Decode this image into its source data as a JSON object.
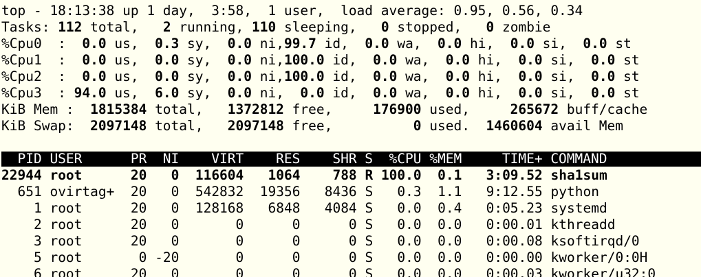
{
  "summary": {
    "line1": "top - 18:13:38 up 1 day,  3:58,  1 user,  load average: 0.95, 0.56, 0.34",
    "tasks": {
      "prefix": "Tasks: ",
      "total": "112",
      "total_label": " total,   ",
      "running": "2",
      "running_label": " running, ",
      "sleeping": "110",
      "sleeping_label": " sleeping,   ",
      "stopped": "0",
      "stopped_label": " stopped,   ",
      "zombie": "0",
      "zombie_label": " zombie"
    },
    "cpus": [
      {
        "label": "%Cpu0  : ",
        "us": " 0.0",
        "sy": " 0.3",
        "ni": " 0.0",
        "id": "99.7",
        "wa": " 0.0",
        "hi": " 0.0",
        "si": " 0.0",
        "st": " 0.0",
        "id_sep": " ni,"
      },
      {
        "label": "%Cpu1  : ",
        "us": " 0.0",
        "sy": " 0.0",
        "ni": " 0.0",
        "id": "100.0",
        "wa": " 0.0",
        "hi": " 0.0",
        "si": " 0.0",
        "st": " 0.0",
        "id_sep": " ni,"
      },
      {
        "label": "%Cpu2  : ",
        "us": " 0.0",
        "sy": " 0.0",
        "ni": " 0.0",
        "id": "100.0",
        "wa": " 0.0",
        "hi": " 0.0",
        "si": " 0.0",
        "st": " 0.0",
        "id_sep": " ni,"
      },
      {
        "label": "%Cpu3  : ",
        "us": "94.0",
        "sy": " 6.0",
        "ni": " 0.0",
        "id": " 0.0",
        "wa": " 0.0",
        "hi": " 0.0",
        "si": " 0.0",
        "st": " 0.0",
        "id_sep": " ni, "
      }
    ],
    "mem": {
      "label": "KiB Mem : ",
      "total": " 1815384",
      "total_label": " total,  ",
      "free": " 1372812",
      "free_label": " free,   ",
      "used": "  176900",
      "used_label": " used,   ",
      "buff": "  265672",
      "buff_label": " buff/cache"
    },
    "swap": {
      "label": "KiB Swap: ",
      "total": " 2097148",
      "total_label": " total,  ",
      "free": " 2097148",
      "free_label": " free,   ",
      "used": "       0",
      "used_label": " used.  ",
      "avail": "1460604",
      "avail_label": " avail Mem"
    }
  },
  "table": {
    "header": "  PID USER      PR  NI    VIRT    RES    SHR S  %CPU %MEM     TIME+ COMMAND          ",
    "rows": [
      {
        "pid": "22944",
        "user": "root     ",
        "pr": "20",
        "ni": "  0",
        "virt": " 116604",
        "res": "  1064",
        "shr": "   788",
        "s": "R",
        "cpu": "100.0",
        "mem": " 0.1",
        "time": "  3:09.52",
        "command": "sha1sum"
      },
      {
        "pid": "  651",
        "user": "ovirtag+ ",
        "pr": "20",
        "ni": "  0",
        "virt": " 542832",
        "res": " 19356",
        "shr": "  8436",
        "s": "S",
        "cpu": "  0.3",
        "mem": " 1.1",
        "time": "  9:12.55",
        "command": "python"
      },
      {
        "pid": "    1",
        "user": "root     ",
        "pr": "20",
        "ni": "  0",
        "virt": " 128168",
        "res": "  6848",
        "shr": "  4084",
        "s": "S",
        "cpu": "  0.0",
        "mem": " 0.4",
        "time": "  0:05.23",
        "command": "systemd"
      },
      {
        "pid": "    2",
        "user": "root     ",
        "pr": "20",
        "ni": "  0",
        "virt": "      0",
        "res": "     0",
        "shr": "     0",
        "s": "S",
        "cpu": "  0.0",
        "mem": " 0.0",
        "time": "  0:00.01",
        "command": "kthreadd"
      },
      {
        "pid": "    3",
        "user": "root     ",
        "pr": "20",
        "ni": "  0",
        "virt": "      0",
        "res": "     0",
        "shr": "     0",
        "s": "S",
        "cpu": "  0.0",
        "mem": " 0.0",
        "time": "  0:00.08",
        "command": "ksoftirqd/0"
      },
      {
        "pid": "    5",
        "user": "root     ",
        "pr": " 0",
        "ni": "-20",
        "virt": "      0",
        "res": "     0",
        "shr": "     0",
        "s": "S",
        "cpu": "  0.0",
        "mem": " 0.0",
        "time": "  0:00.00",
        "command": "kworker/0:0H"
      },
      {
        "pid": "    6",
        "user": "root     ",
        "pr": "20",
        "ni": "  0",
        "virt": "      0",
        "res": "     0",
        "shr": "     0",
        "s": "S",
        "cpu": "  0.0",
        "mem": " 0.0",
        "time": "  0:00.03",
        "command": "kworker/u32:0"
      }
    ]
  },
  "colors": {
    "background": "#fffff0",
    "foreground": "#000000",
    "header_bg": "#000000",
    "header_fg": "#ffffff"
  }
}
